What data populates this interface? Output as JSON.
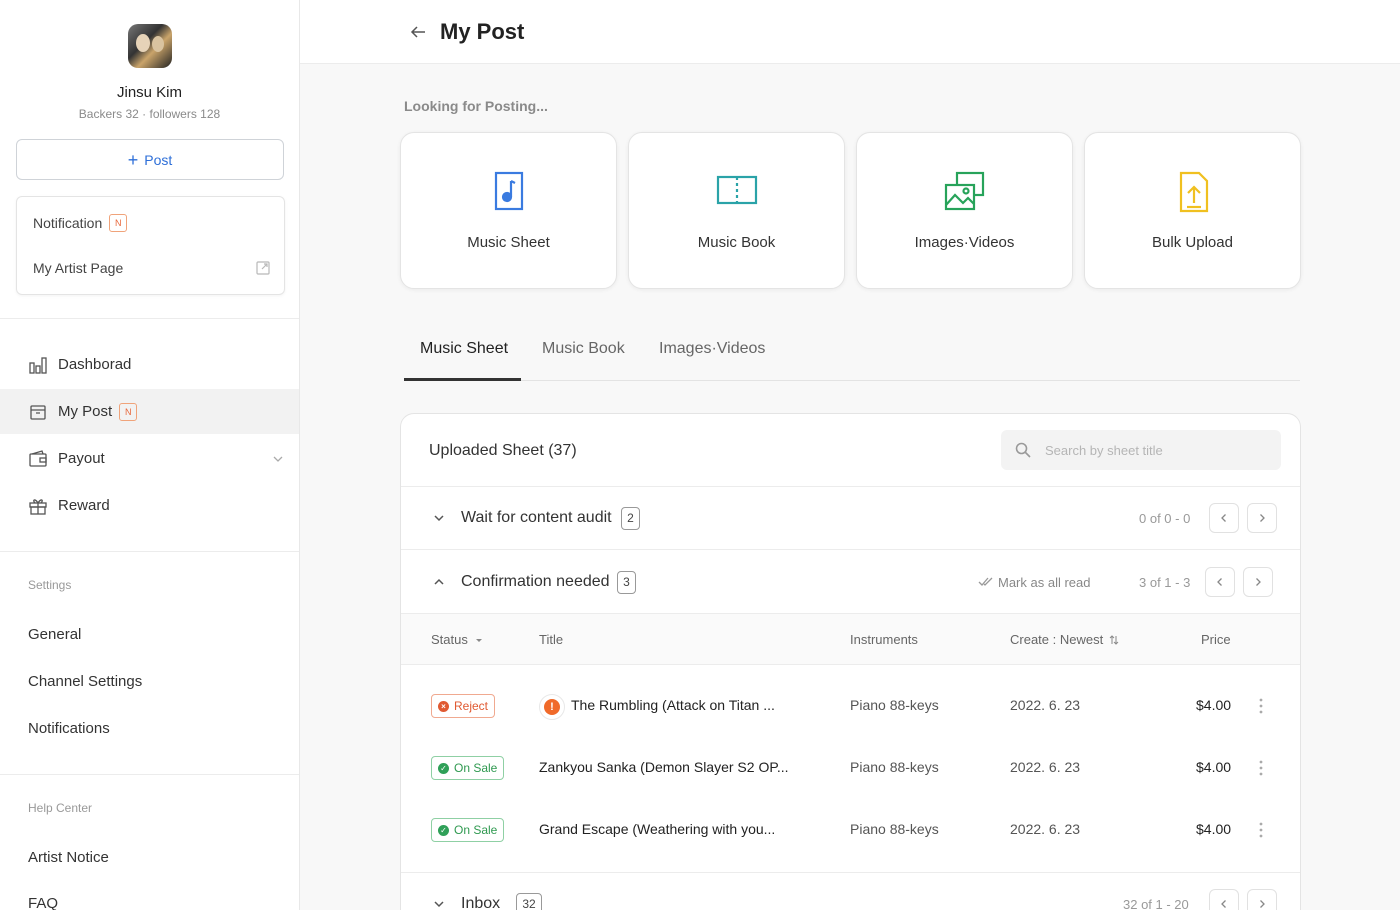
{
  "profile": {
    "name": "Jinsu Kim",
    "stats": "Backers 32 · followers 128"
  },
  "sidebar": {
    "post_button": "Post",
    "quick": {
      "notification": "Notification",
      "notification_badge": "N",
      "artist_page": "My Artist Page"
    },
    "nav": [
      {
        "label": "Dashborad",
        "icon": "bar-chart-icon"
      },
      {
        "label": "My Post",
        "icon": "post-box-icon",
        "badge": "N",
        "active": true
      },
      {
        "label": "Payout",
        "icon": "wallet-icon",
        "has_dropdown": true
      },
      {
        "label": "Reward",
        "icon": "gift-icon"
      }
    ],
    "settings_label": "Settings",
    "settings_items": [
      "General",
      "Channel Settings",
      "Notifications"
    ],
    "help_label": "Help Center",
    "help_items": [
      "Artist Notice",
      "FAQ"
    ]
  },
  "header": {
    "title": "My Post"
  },
  "posting": {
    "label": "Looking for Posting...",
    "cards": [
      {
        "label": "Music Sheet",
        "icon": "music-sheet-icon",
        "color": "#3a7be0"
      },
      {
        "label": "Music Book",
        "icon": "music-book-icon",
        "color": "#2aa3a8"
      },
      {
        "label": "Images·Videos",
        "icon": "images-videos-icon",
        "color": "#27a35a"
      },
      {
        "label": "Bulk Upload",
        "icon": "bulk-upload-icon",
        "color": "#f0c020"
      }
    ]
  },
  "tabs": [
    {
      "label": "Music Sheet",
      "active": true
    },
    {
      "label": "Music Book"
    },
    {
      "label": "Images·Videos"
    }
  ],
  "panel": {
    "title": "Uploaded Sheet (37)",
    "search_placeholder": "Search by sheet title",
    "groups": {
      "audit": {
        "label": "Wait for content audit",
        "count": "2",
        "pager": "0 of 0 - 0"
      },
      "confirm": {
        "label": "Confirmation needed",
        "count": "3",
        "pager": "3 of 1 - 3",
        "mark_read": "Mark as all read"
      },
      "inbox": {
        "label": "Inbox",
        "count": "32",
        "pager": "32 of 1 - 20"
      }
    },
    "columns": {
      "status": "Status",
      "title": "Title",
      "instruments": "Instruments",
      "create": "Create : Newest",
      "price": "Price"
    },
    "rows": [
      {
        "status": "Reject",
        "status_type": "reject",
        "warning": true,
        "title": "The Rumbling (Attack on Titan ...",
        "instruments": "Piano 88-keys",
        "date": "2022. 6. 23",
        "price": "$4.00"
      },
      {
        "status": "On Sale",
        "status_type": "sale",
        "warning": false,
        "title": "Zankyou Sanka (Demon Slayer S2 OP...",
        "instruments": "Piano 88-keys",
        "date": "2022. 6. 23",
        "price": "$4.00"
      },
      {
        "status": "On Sale",
        "status_type": "sale",
        "warning": false,
        "title": "Grand Escape (Weathering with you...",
        "instruments": "Piano 88-keys",
        "date": "2022. 6. 23",
        "price": "$4.00"
      }
    ]
  },
  "colors": {
    "accent": "#2e6fd8",
    "reject": "#e05a32",
    "on_sale": "#2f9950",
    "badge_new": "#e8663a"
  }
}
